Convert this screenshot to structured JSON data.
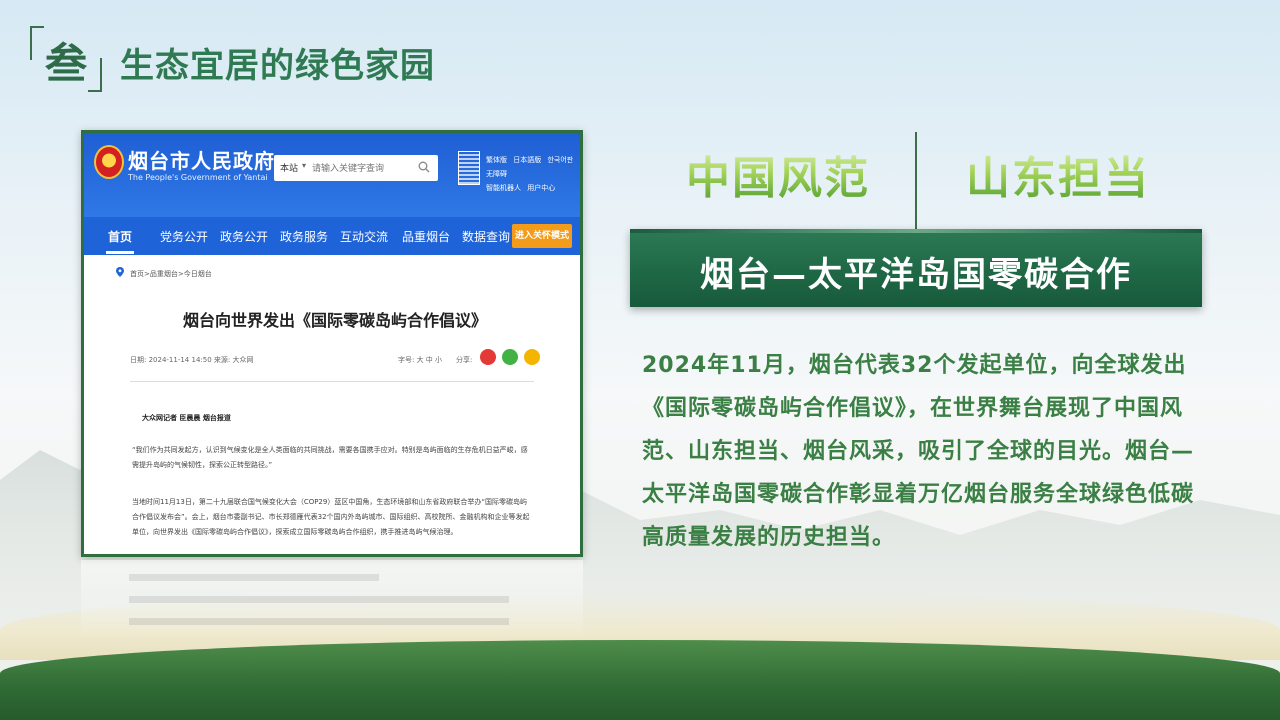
{
  "header": {
    "badge_char": "叁",
    "title": "生态宜居的绿色家园"
  },
  "screenshot": {
    "gov_name": "烟台市人民政府",
    "gov_name_en": "The People's Government of Yantai",
    "search": {
      "scope": "本站",
      "placeholder": "请输入关键字查询"
    },
    "top_links": [
      "繁体版",
      "日本語版",
      "한국어판",
      "无障碍",
      "智能机器人",
      "用户中心"
    ],
    "nav": [
      "首页",
      "党务公开",
      "政务公开",
      "政务服务",
      "互动交流",
      "品重烟台",
      "数据查询"
    ],
    "care_mode": "进入关怀模式",
    "breadcrumb": "首页>品重烟台>今日烟台",
    "article_title": "烟台向世界发出《国际零碳岛屿合作倡议》",
    "date": "日期: 2024-11-14 14:50   来源: 大众网",
    "font_size_label": "字号:  大 中 小",
    "share_label": "分享:",
    "byline": "大众网记者 臣晨晨 烟台报道",
    "paragraphs": [
      "“我们作为共同发起方，认识到气候变化是全人类面临的共同挑战，需要各国携手应对。特别是岛屿面临的生存危机日益严峻，感需提升岛屿的气候韧性，探索公正转型路径。”",
      "当地时间11月13日，第二十九届联合国气候变化大会（COP29）蓝区中国角，生态环境部和山东省政府联合举办“国际零碳岛屿合作倡议发布会”。会上，烟台市委副书记、市长郑德雁代表32个国内外岛屿城市、国际组织、高校院所、金融机构和企业等发起单位，向世界发出《国际零碳岛屿合作倡议》，探索成立国际零碳岛屿合作组织，携手推进岛屿气候治理。"
    ]
  },
  "right": {
    "slogan_left": "中国风范",
    "slogan_right": "山东担当",
    "banner": "烟台—太平洋岛国零碳合作",
    "body": "2024年11月，烟台代表32个发起单位，向全球发出《国际零碳岛屿合作倡议》，在世界舞台展现了中国风范、山东担当、烟台风采，吸引了全球的目光。烟台—太平洋岛国零碳合作彰显着万亿烟台服务全球绿色低碳高质量发展的历史担当。"
  },
  "colors": {
    "title_green": "#2f7a52",
    "banner_green": "#1f6846",
    "body_green": "#3a7f44",
    "gov_blue": "#1f63d8",
    "care_orange": "#f39b1a"
  }
}
